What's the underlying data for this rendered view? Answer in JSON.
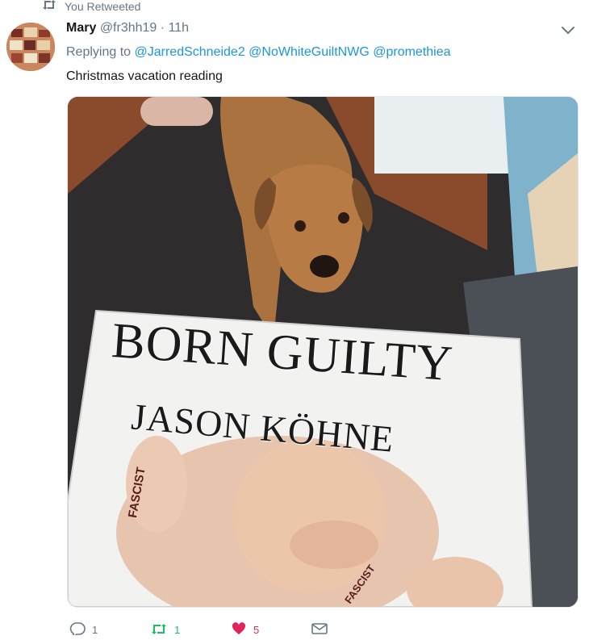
{
  "retweet_context": {
    "label": "You Retweeted",
    "icon": "retweet-icon"
  },
  "tweet": {
    "author_name": "Mary",
    "author_handle": "@fr3hh19",
    "separator": "·",
    "time": "11h",
    "replying_to_prefix": "Replying to",
    "mentions": [
      "@JarredSchneide2",
      "@NoWhiteGuiltNWG",
      "@promethiea"
    ],
    "text": "Christmas vacation reading",
    "media": {
      "book_title_line1": "Born Guilty",
      "book_author": "Jason Köhne",
      "tattoo_text_1": "FASCIST",
      "tattoo_text_2": "FASCIST"
    }
  },
  "actions": {
    "reply_count": "1",
    "retweet_count": "1",
    "like_count": "5"
  },
  "colors": {
    "link": "#1b95e0",
    "muted": "#657786",
    "retweet_green": "#17bf63",
    "like_red": "#e0245e"
  }
}
